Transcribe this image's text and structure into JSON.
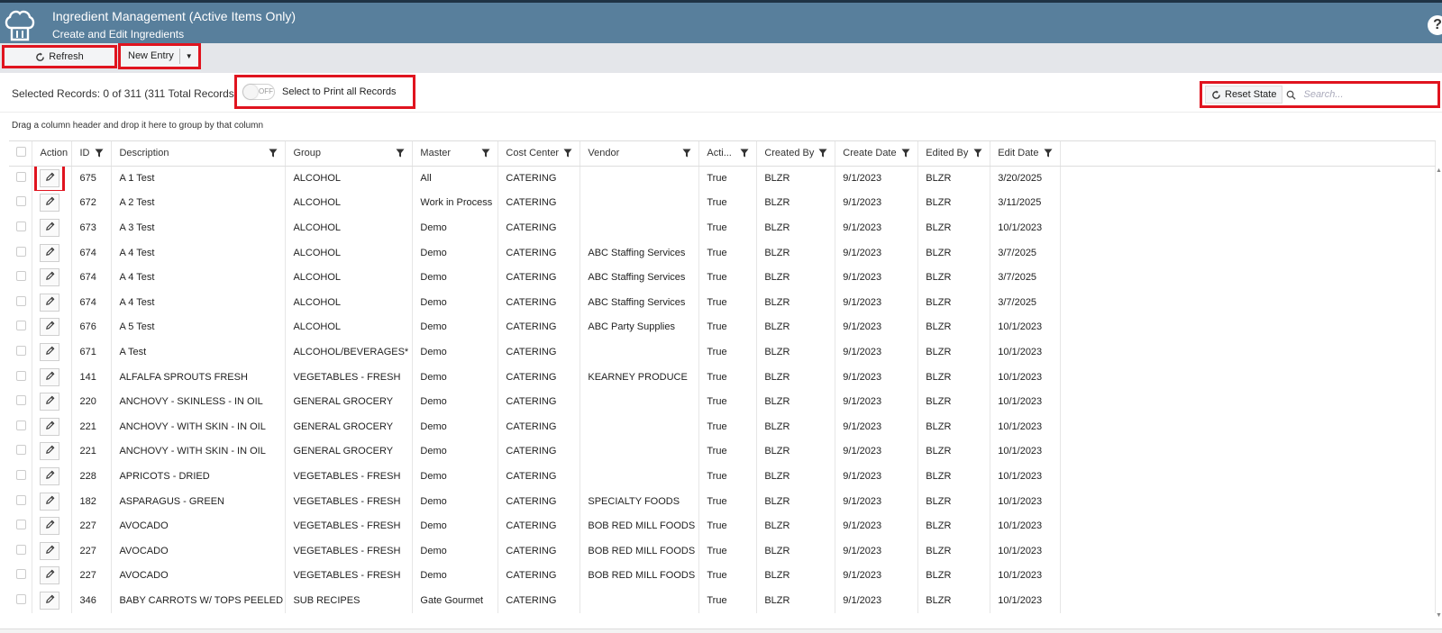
{
  "header": {
    "title": "Ingredient Management (Active Items Only)",
    "subtitle": "Create and Edit Ingredients",
    "logo_icon": "chef-hat-icon",
    "help_icon": "help-icon",
    "help_label": "?",
    "bg_color": "#587f9c"
  },
  "toolbar": {
    "refresh_label": "Refresh",
    "new_entry_label": "New Entry"
  },
  "status": {
    "selected_records": "Selected Records: 0 of 311 (311 Total Records)",
    "toggle_state": "OFF",
    "print_label": "Select to Print all Records",
    "reset_label": "Reset State",
    "search_placeholder": "Search..."
  },
  "group_panel_text": "Drag a column header and drop it here to group by that column",
  "columns": [
    "Action",
    "ID",
    "Description",
    "Group",
    "Master",
    "Cost Center",
    "Vendor",
    "Acti...",
    "Created By",
    "Create Date",
    "Edited By",
    "Edit Date"
  ],
  "rows": [
    [
      "675",
      "A 1 Test",
      "ALCOHOL",
      "All",
      "CATERING",
      "",
      "True",
      "BLZR",
      "9/1/2023",
      "BLZR",
      "3/20/2025"
    ],
    [
      "672",
      "A 2 Test",
      "ALCOHOL",
      "Work in Process",
      "CATERING",
      "",
      "True",
      "BLZR",
      "9/1/2023",
      "BLZR",
      "3/11/2025"
    ],
    [
      "673",
      "A 3 Test",
      "ALCOHOL",
      "Demo",
      "CATERING",
      "",
      "True",
      "BLZR",
      "9/1/2023",
      "BLZR",
      "10/1/2023"
    ],
    [
      "674",
      "A 4 Test",
      "ALCOHOL",
      "Demo",
      "CATERING",
      "ABC Staffing Services",
      "True",
      "BLZR",
      "9/1/2023",
      "BLZR",
      "3/7/2025"
    ],
    [
      "674",
      "A 4 Test",
      "ALCOHOL",
      "Demo",
      "CATERING",
      "ABC Staffing Services",
      "True",
      "BLZR",
      "9/1/2023",
      "BLZR",
      "3/7/2025"
    ],
    [
      "674",
      "A 4 Test",
      "ALCOHOL",
      "Demo",
      "CATERING",
      "ABC Staffing Services",
      "True",
      "BLZR",
      "9/1/2023",
      "BLZR",
      "3/7/2025"
    ],
    [
      "676",
      "A 5 Test",
      "ALCOHOL",
      "Demo",
      "CATERING",
      "ABC Party Supplies",
      "True",
      "BLZR",
      "9/1/2023",
      "BLZR",
      "10/1/2023"
    ],
    [
      "671",
      "A Test",
      "ALCOHOL/BEVERAGES*",
      "Demo",
      "CATERING",
      "",
      "True",
      "BLZR",
      "9/1/2023",
      "BLZR",
      "10/1/2023"
    ],
    [
      "141",
      "ALFALFA SPROUTS FRESH",
      "VEGETABLES - FRESH",
      "Demo",
      "CATERING",
      "KEARNEY PRODUCE",
      "True",
      "BLZR",
      "9/1/2023",
      "BLZR",
      "10/1/2023"
    ],
    [
      "220",
      "ANCHOVY - SKINLESS - IN OIL",
      "GENERAL GROCERY",
      "Demo",
      "CATERING",
      "",
      "True",
      "BLZR",
      "9/1/2023",
      "BLZR",
      "10/1/2023"
    ],
    [
      "221",
      "ANCHOVY - WITH SKIN - IN OIL",
      "GENERAL GROCERY",
      "Demo",
      "CATERING",
      "",
      "True",
      "BLZR",
      "9/1/2023",
      "BLZR",
      "10/1/2023"
    ],
    [
      "221",
      "ANCHOVY - WITH SKIN - IN OIL",
      "GENERAL GROCERY",
      "Demo",
      "CATERING",
      "",
      "True",
      "BLZR",
      "9/1/2023",
      "BLZR",
      "10/1/2023"
    ],
    [
      "228",
      "APRICOTS - DRIED",
      "VEGETABLES - FRESH",
      "Demo",
      "CATERING",
      "",
      "True",
      "BLZR",
      "9/1/2023",
      "BLZR",
      "10/1/2023"
    ],
    [
      "182",
      "ASPARAGUS - GREEN",
      "VEGETABLES - FRESH",
      "Demo",
      "CATERING",
      "SPECIALTY FOODS",
      "True",
      "BLZR",
      "9/1/2023",
      "BLZR",
      "10/1/2023"
    ],
    [
      "227",
      "AVOCADO",
      "VEGETABLES - FRESH",
      "Demo",
      "CATERING",
      "BOB RED MILL FOODS",
      "True",
      "BLZR",
      "9/1/2023",
      "BLZR",
      "10/1/2023"
    ],
    [
      "227",
      "AVOCADO",
      "VEGETABLES - FRESH",
      "Demo",
      "CATERING",
      "BOB RED MILL FOODS",
      "True",
      "BLZR",
      "9/1/2023",
      "BLZR",
      "10/1/2023"
    ],
    [
      "227",
      "AVOCADO",
      "VEGETABLES - FRESH",
      "Demo",
      "CATERING",
      "BOB RED MILL FOODS",
      "True",
      "BLZR",
      "9/1/2023",
      "BLZR",
      "10/1/2023"
    ],
    [
      "346",
      "BABY CARROTS W/ TOPS PEELED",
      "SUB RECIPES",
      "Gate Gourmet",
      "CATERING",
      "",
      "True",
      "BLZR",
      "9/1/2023",
      "BLZR",
      "10/1/2023"
    ]
  ],
  "highlight_color": "#e0141f"
}
